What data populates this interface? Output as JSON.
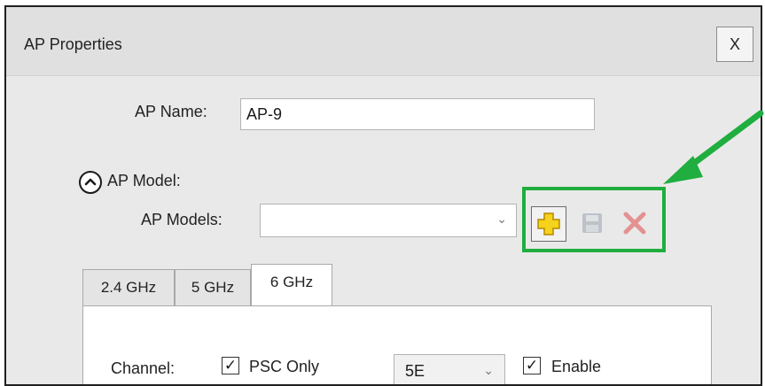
{
  "window": {
    "title": "AP Properties",
    "close_label": "X"
  },
  "fields": {
    "ap_name_label": "AP Name:",
    "ap_name_value": "AP-9",
    "ap_model_label": "AP Model:",
    "ap_models_label": "AP Models:",
    "ap_models_value": ""
  },
  "toolbar": {
    "icons": [
      "add-icon",
      "save-icon",
      "delete-icon"
    ]
  },
  "tabs": [
    {
      "label": "2.4 GHz"
    },
    {
      "label": "5 GHz"
    },
    {
      "label": "6 GHz",
      "active": true
    }
  ],
  "channel": {
    "label": "Channel:",
    "psc_only_label": "PSC Only",
    "psc_only_checked": true,
    "channel_value": "5E",
    "enable_label": "Enable",
    "enable_checked": true,
    "check_glyph": "✓"
  },
  "colors": {
    "highlight": "#1fae3f",
    "add_icon": "#f5d21b",
    "delete_icon": "#e04a4a"
  }
}
